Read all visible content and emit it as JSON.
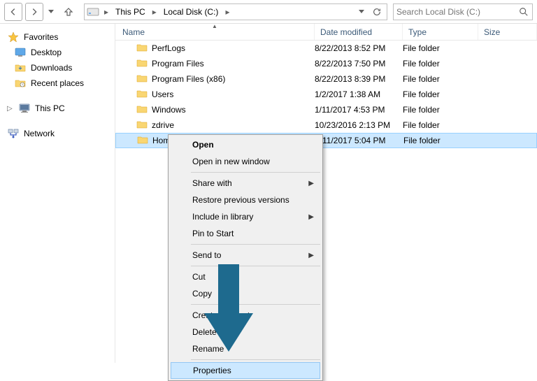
{
  "breadcrumb": {
    "parts": [
      "This PC",
      "Local Disk (C:)"
    ]
  },
  "search": {
    "placeholder": "Search Local Disk (C:)"
  },
  "sidebar": {
    "favorites": {
      "label": "Favorites",
      "items": [
        "Desktop",
        "Downloads",
        "Recent places"
      ]
    },
    "thispc": {
      "label": "This PC"
    },
    "network": {
      "label": "Network"
    }
  },
  "columns": {
    "name": "Name",
    "date": "Date modified",
    "type": "Type",
    "size": "Size"
  },
  "files": [
    {
      "name": "PerfLogs",
      "date": "8/22/2013 8:52 PM",
      "type": "File folder"
    },
    {
      "name": "Program Files",
      "date": "8/22/2013 7:50 PM",
      "type": "File folder"
    },
    {
      "name": "Program Files (x86)",
      "date": "8/22/2013 8:39 PM",
      "type": "File folder"
    },
    {
      "name": "Users",
      "date": "1/2/2017 1:38 AM",
      "type": "File folder"
    },
    {
      "name": "Windows",
      "date": "1/11/2017 4:53 PM",
      "type": "File folder"
    },
    {
      "name": "zdrive",
      "date": "10/23/2016 2:13 PM",
      "type": "File folder"
    },
    {
      "name": "HomeFolder",
      "date": "1/11/2017 5:04 PM",
      "type": "File folder",
      "selected": true
    }
  ],
  "context_menu": {
    "items": [
      {
        "label": "Open",
        "bold": true
      },
      {
        "label": "Open in new window"
      },
      {
        "sep": true
      },
      {
        "label": "Share with",
        "submenu": true
      },
      {
        "label": "Restore previous versions"
      },
      {
        "label": "Include in library",
        "submenu": true
      },
      {
        "label": "Pin to Start"
      },
      {
        "sep": true
      },
      {
        "label": "Send to",
        "submenu": true
      },
      {
        "sep": true
      },
      {
        "label": "Cut"
      },
      {
        "label": "Copy"
      },
      {
        "sep": true
      },
      {
        "label": "Create shortcut"
      },
      {
        "label": "Delete"
      },
      {
        "label": "Rename"
      },
      {
        "sep": true
      },
      {
        "label": "Properties",
        "highlighted": true
      }
    ]
  }
}
